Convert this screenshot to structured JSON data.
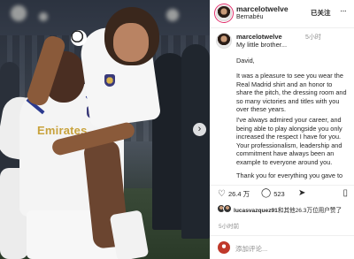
{
  "post": {
    "username": "marcelotwelve",
    "location": "Bernabéu",
    "follow_label": "已关注",
    "more_label": "···",
    "next_image_label": "›"
  },
  "caption": {
    "username": "marcelotwelve",
    "time": "5小时",
    "first_line": "My little brother...",
    "greeting": "David,",
    "para1": "It was a pleasure to see you wear the Real Madrid shirt and an honor to share the pitch, the dressing room and so many victories and titles with you over these years.",
    "para2": "I've always admired your career, and being able to play alongside you only increased the respect I have for you. Your professionalism, leadership and commitment have always been an example to everyone around you.",
    "para3": "Thank you for everything you gave to"
  },
  "actions": {
    "like_icon": "heart-icon",
    "like_count": "26.4 万",
    "comment_icon": "comment-icon",
    "comment_count": "523",
    "share_icon": "share-icon",
    "bookmark_icon": "bookmark-icon"
  },
  "liked_by": {
    "text_user": "lucasvazquez91",
    "text_rest": "和其他26.3万位用户赞了"
  },
  "time_ago": "5小时前",
  "comment_box": {
    "placeholder": "添加评论..."
  },
  "photo": {
    "sponsor_text": "Emirates"
  }
}
